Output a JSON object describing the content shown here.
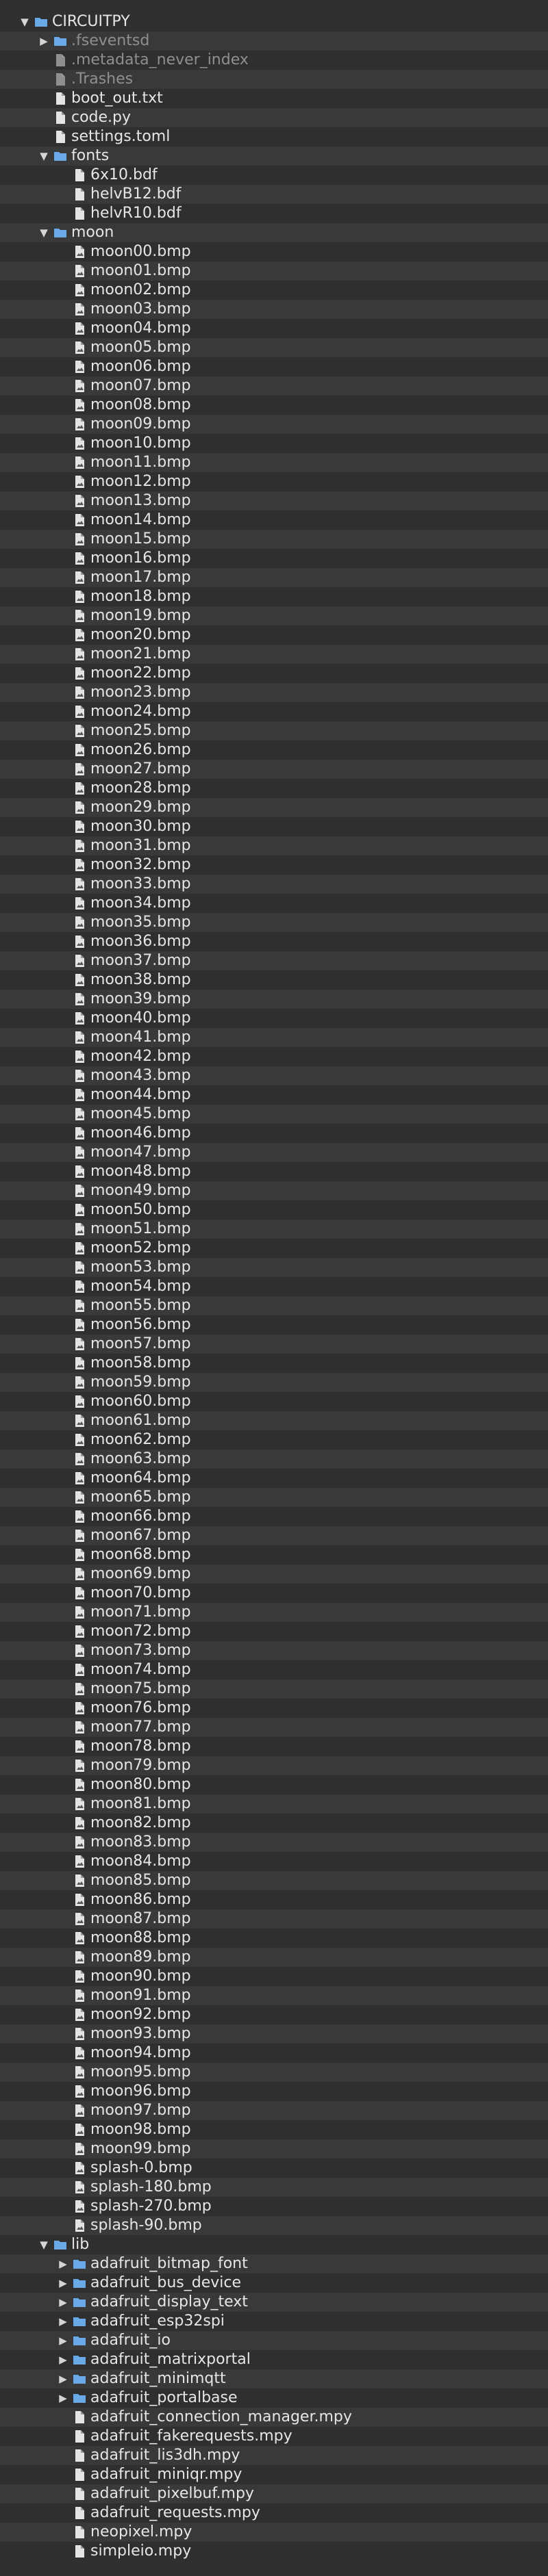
{
  "tree": [
    {
      "label": "CIRCUITPY",
      "type": "folder",
      "depth": 0,
      "expanded": true
    },
    {
      "label": ".fseventsd",
      "type": "folder",
      "depth": 1,
      "expanded": false,
      "dim": true
    },
    {
      "label": ".metadata_never_index",
      "type": "file",
      "depth": 1,
      "dim": true
    },
    {
      "label": ".Trashes",
      "type": "file",
      "depth": 1,
      "dim": true
    },
    {
      "label": "boot_out.txt",
      "type": "file",
      "depth": 1
    },
    {
      "label": "code.py",
      "type": "file",
      "depth": 1
    },
    {
      "label": "settings.toml",
      "type": "file",
      "depth": 1
    },
    {
      "label": "fonts",
      "type": "folder",
      "depth": 1,
      "expanded": true
    },
    {
      "label": "6x10.bdf",
      "type": "file",
      "depth": 2
    },
    {
      "label": "helvB12.bdf",
      "type": "file",
      "depth": 2
    },
    {
      "label": "helvR10.bdf",
      "type": "file",
      "depth": 2
    },
    {
      "label": "moon",
      "type": "folder",
      "depth": 1,
      "expanded": true
    },
    {
      "label": "moon00.bmp",
      "type": "image",
      "depth": 2
    },
    {
      "label": "moon01.bmp",
      "type": "image",
      "depth": 2
    },
    {
      "label": "moon02.bmp",
      "type": "image",
      "depth": 2
    },
    {
      "label": "moon03.bmp",
      "type": "image",
      "depth": 2
    },
    {
      "label": "moon04.bmp",
      "type": "image",
      "depth": 2
    },
    {
      "label": "moon05.bmp",
      "type": "image",
      "depth": 2
    },
    {
      "label": "moon06.bmp",
      "type": "image",
      "depth": 2
    },
    {
      "label": "moon07.bmp",
      "type": "image",
      "depth": 2
    },
    {
      "label": "moon08.bmp",
      "type": "image",
      "depth": 2
    },
    {
      "label": "moon09.bmp",
      "type": "image",
      "depth": 2
    },
    {
      "label": "moon10.bmp",
      "type": "image",
      "depth": 2
    },
    {
      "label": "moon11.bmp",
      "type": "image",
      "depth": 2
    },
    {
      "label": "moon12.bmp",
      "type": "image",
      "depth": 2
    },
    {
      "label": "moon13.bmp",
      "type": "image",
      "depth": 2
    },
    {
      "label": "moon14.bmp",
      "type": "image",
      "depth": 2
    },
    {
      "label": "moon15.bmp",
      "type": "image",
      "depth": 2
    },
    {
      "label": "moon16.bmp",
      "type": "image",
      "depth": 2
    },
    {
      "label": "moon17.bmp",
      "type": "image",
      "depth": 2
    },
    {
      "label": "moon18.bmp",
      "type": "image",
      "depth": 2
    },
    {
      "label": "moon19.bmp",
      "type": "image",
      "depth": 2
    },
    {
      "label": "moon20.bmp",
      "type": "image",
      "depth": 2
    },
    {
      "label": "moon21.bmp",
      "type": "image",
      "depth": 2
    },
    {
      "label": "moon22.bmp",
      "type": "image",
      "depth": 2
    },
    {
      "label": "moon23.bmp",
      "type": "image",
      "depth": 2
    },
    {
      "label": "moon24.bmp",
      "type": "image",
      "depth": 2
    },
    {
      "label": "moon25.bmp",
      "type": "image",
      "depth": 2
    },
    {
      "label": "moon26.bmp",
      "type": "image",
      "depth": 2
    },
    {
      "label": "moon27.bmp",
      "type": "image",
      "depth": 2
    },
    {
      "label": "moon28.bmp",
      "type": "image",
      "depth": 2
    },
    {
      "label": "moon29.bmp",
      "type": "image",
      "depth": 2
    },
    {
      "label": "moon30.bmp",
      "type": "image",
      "depth": 2
    },
    {
      "label": "moon31.bmp",
      "type": "image",
      "depth": 2
    },
    {
      "label": "moon32.bmp",
      "type": "image",
      "depth": 2
    },
    {
      "label": "moon33.bmp",
      "type": "image",
      "depth": 2
    },
    {
      "label": "moon34.bmp",
      "type": "image",
      "depth": 2
    },
    {
      "label": "moon35.bmp",
      "type": "image",
      "depth": 2
    },
    {
      "label": "moon36.bmp",
      "type": "image",
      "depth": 2
    },
    {
      "label": "moon37.bmp",
      "type": "image",
      "depth": 2
    },
    {
      "label": "moon38.bmp",
      "type": "image",
      "depth": 2
    },
    {
      "label": "moon39.bmp",
      "type": "image",
      "depth": 2
    },
    {
      "label": "moon40.bmp",
      "type": "image",
      "depth": 2
    },
    {
      "label": "moon41.bmp",
      "type": "image",
      "depth": 2
    },
    {
      "label": "moon42.bmp",
      "type": "image",
      "depth": 2
    },
    {
      "label": "moon43.bmp",
      "type": "image",
      "depth": 2
    },
    {
      "label": "moon44.bmp",
      "type": "image",
      "depth": 2
    },
    {
      "label": "moon45.bmp",
      "type": "image",
      "depth": 2
    },
    {
      "label": "moon46.bmp",
      "type": "image",
      "depth": 2
    },
    {
      "label": "moon47.bmp",
      "type": "image",
      "depth": 2
    },
    {
      "label": "moon48.bmp",
      "type": "image",
      "depth": 2
    },
    {
      "label": "moon49.bmp",
      "type": "image",
      "depth": 2
    },
    {
      "label": "moon50.bmp",
      "type": "image",
      "depth": 2
    },
    {
      "label": "moon51.bmp",
      "type": "image",
      "depth": 2
    },
    {
      "label": "moon52.bmp",
      "type": "image",
      "depth": 2
    },
    {
      "label": "moon53.bmp",
      "type": "image",
      "depth": 2
    },
    {
      "label": "moon54.bmp",
      "type": "image",
      "depth": 2
    },
    {
      "label": "moon55.bmp",
      "type": "image",
      "depth": 2
    },
    {
      "label": "moon56.bmp",
      "type": "image",
      "depth": 2
    },
    {
      "label": "moon57.bmp",
      "type": "image",
      "depth": 2
    },
    {
      "label": "moon58.bmp",
      "type": "image",
      "depth": 2
    },
    {
      "label": "moon59.bmp",
      "type": "image",
      "depth": 2
    },
    {
      "label": "moon60.bmp",
      "type": "image",
      "depth": 2
    },
    {
      "label": "moon61.bmp",
      "type": "image",
      "depth": 2
    },
    {
      "label": "moon62.bmp",
      "type": "image",
      "depth": 2
    },
    {
      "label": "moon63.bmp",
      "type": "image",
      "depth": 2
    },
    {
      "label": "moon64.bmp",
      "type": "image",
      "depth": 2
    },
    {
      "label": "moon65.bmp",
      "type": "image",
      "depth": 2
    },
    {
      "label": "moon66.bmp",
      "type": "image",
      "depth": 2
    },
    {
      "label": "moon67.bmp",
      "type": "image",
      "depth": 2
    },
    {
      "label": "moon68.bmp",
      "type": "image",
      "depth": 2
    },
    {
      "label": "moon69.bmp",
      "type": "image",
      "depth": 2
    },
    {
      "label": "moon70.bmp",
      "type": "image",
      "depth": 2
    },
    {
      "label": "moon71.bmp",
      "type": "image",
      "depth": 2
    },
    {
      "label": "moon72.bmp",
      "type": "image",
      "depth": 2
    },
    {
      "label": "moon73.bmp",
      "type": "image",
      "depth": 2
    },
    {
      "label": "moon74.bmp",
      "type": "image",
      "depth": 2
    },
    {
      "label": "moon75.bmp",
      "type": "image",
      "depth": 2
    },
    {
      "label": "moon76.bmp",
      "type": "image",
      "depth": 2
    },
    {
      "label": "moon77.bmp",
      "type": "image",
      "depth": 2
    },
    {
      "label": "moon78.bmp",
      "type": "image",
      "depth": 2
    },
    {
      "label": "moon79.bmp",
      "type": "image",
      "depth": 2
    },
    {
      "label": "moon80.bmp",
      "type": "image",
      "depth": 2
    },
    {
      "label": "moon81.bmp",
      "type": "image",
      "depth": 2
    },
    {
      "label": "moon82.bmp",
      "type": "image",
      "depth": 2
    },
    {
      "label": "moon83.bmp",
      "type": "image",
      "depth": 2
    },
    {
      "label": "moon84.bmp",
      "type": "image",
      "depth": 2
    },
    {
      "label": "moon85.bmp",
      "type": "image",
      "depth": 2
    },
    {
      "label": "moon86.bmp",
      "type": "image",
      "depth": 2
    },
    {
      "label": "moon87.bmp",
      "type": "image",
      "depth": 2
    },
    {
      "label": "moon88.bmp",
      "type": "image",
      "depth": 2
    },
    {
      "label": "moon89.bmp",
      "type": "image",
      "depth": 2
    },
    {
      "label": "moon90.bmp",
      "type": "image",
      "depth": 2
    },
    {
      "label": "moon91.bmp",
      "type": "image",
      "depth": 2
    },
    {
      "label": "moon92.bmp",
      "type": "image",
      "depth": 2
    },
    {
      "label": "moon93.bmp",
      "type": "image",
      "depth": 2
    },
    {
      "label": "moon94.bmp",
      "type": "image",
      "depth": 2
    },
    {
      "label": "moon95.bmp",
      "type": "image",
      "depth": 2
    },
    {
      "label": "moon96.bmp",
      "type": "image",
      "depth": 2
    },
    {
      "label": "moon97.bmp",
      "type": "image",
      "depth": 2
    },
    {
      "label": "moon98.bmp",
      "type": "image",
      "depth": 2
    },
    {
      "label": "moon99.bmp",
      "type": "image",
      "depth": 2
    },
    {
      "label": "splash-0.bmp",
      "type": "image",
      "depth": 2
    },
    {
      "label": "splash-180.bmp",
      "type": "image",
      "depth": 2
    },
    {
      "label": "splash-270.bmp",
      "type": "image",
      "depth": 2
    },
    {
      "label": "splash-90.bmp",
      "type": "image",
      "depth": 2
    },
    {
      "label": "lib",
      "type": "folder",
      "depth": 1,
      "expanded": true
    },
    {
      "label": "adafruit_bitmap_font",
      "type": "folder",
      "depth": 2,
      "expanded": false
    },
    {
      "label": "adafruit_bus_device",
      "type": "folder",
      "depth": 2,
      "expanded": false
    },
    {
      "label": "adafruit_display_text",
      "type": "folder",
      "depth": 2,
      "expanded": false
    },
    {
      "label": "adafruit_esp32spi",
      "type": "folder",
      "depth": 2,
      "expanded": false
    },
    {
      "label": "adafruit_io",
      "type": "folder",
      "depth": 2,
      "expanded": false
    },
    {
      "label": "adafruit_matrixportal",
      "type": "folder",
      "depth": 2,
      "expanded": false
    },
    {
      "label": "adafruit_minimqtt",
      "type": "folder",
      "depth": 2,
      "expanded": false
    },
    {
      "label": "adafruit_portalbase",
      "type": "folder",
      "depth": 2,
      "expanded": false
    },
    {
      "label": "adafruit_connection_manager.mpy",
      "type": "file",
      "depth": 2
    },
    {
      "label": "adafruit_fakerequests.mpy",
      "type": "file",
      "depth": 2
    },
    {
      "label": "adafruit_lis3dh.mpy",
      "type": "file",
      "depth": 2
    },
    {
      "label": "adafruit_miniqr.mpy",
      "type": "file",
      "depth": 2
    },
    {
      "label": "adafruit_pixelbuf.mpy",
      "type": "file",
      "depth": 2
    },
    {
      "label": "adafruit_requests.mpy",
      "type": "file",
      "depth": 2
    },
    {
      "label": "neopixel.mpy",
      "type": "file",
      "depth": 2
    },
    {
      "label": "simpleio.mpy",
      "type": "file",
      "depth": 2
    }
  ],
  "colors": {
    "background": "#2f2f2f",
    "stripe": "#393939",
    "text": "#e6e6e6",
    "dim_text": "#8f8f8f",
    "folder": "#6aa9e6",
    "file": "#e4e4e4"
  }
}
